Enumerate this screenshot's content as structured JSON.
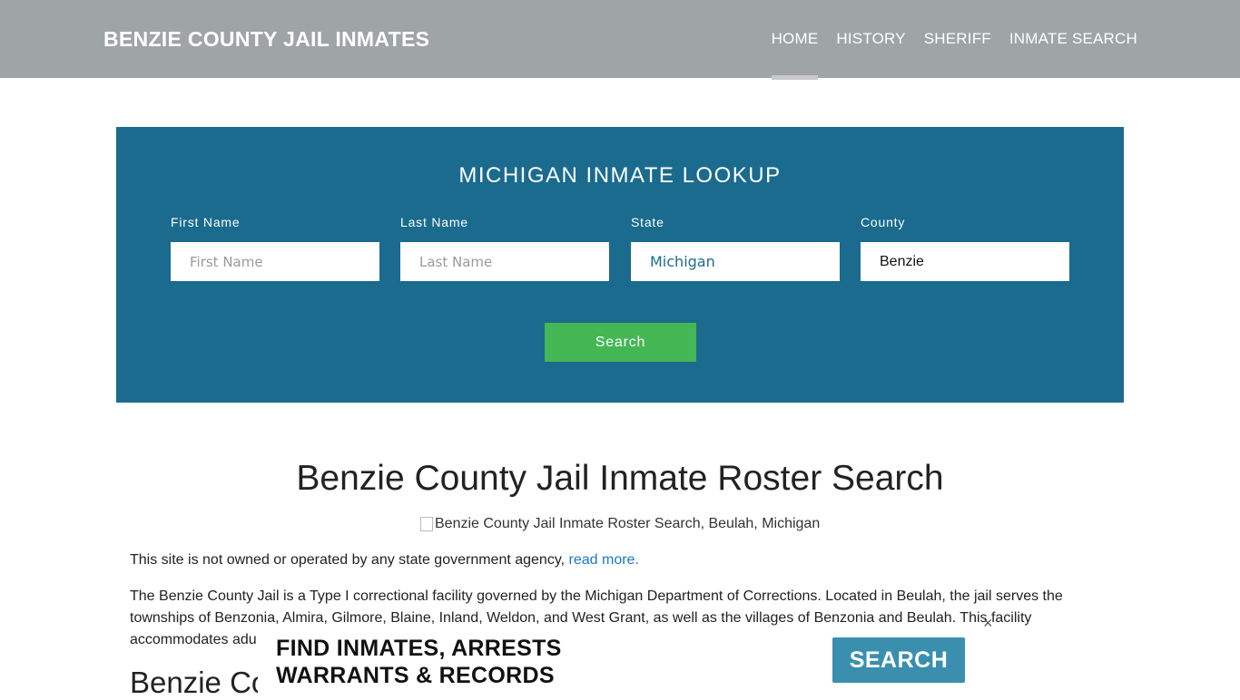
{
  "header": {
    "brand": "BENZIE COUNTY JAIL INMATES",
    "nav": [
      {
        "label": "HOME",
        "active": true
      },
      {
        "label": "HISTORY",
        "active": false
      },
      {
        "label": "SHERIFF",
        "active": false
      },
      {
        "label": "INMATE SEARCH",
        "active": false
      }
    ]
  },
  "lookup": {
    "title": "MICHIGAN INMATE LOOKUP",
    "fields": {
      "first_name": {
        "label": "First Name",
        "placeholder": "First Name",
        "value": ""
      },
      "last_name": {
        "label": "Last Name",
        "placeholder": "Last Name",
        "value": ""
      },
      "state": {
        "label": "State",
        "value": "Michigan"
      },
      "county": {
        "label": "County",
        "value": "Benzie"
      }
    },
    "search_label": "Search"
  },
  "content": {
    "title": "Benzie County Jail Inmate Roster Search",
    "image_alt": "Benzie County Jail Inmate Roster Search, Beulah, Michigan",
    "disclaimer_text": "This site is not owned or operated by any state government agency, ",
    "disclaimer_link": "read more.",
    "body_text": "The Benzie County Jail is a Type I correctional facility governed by the Michigan Department of Corrections. Located in Beulah, the jail serves the townships of Benzonia, Almira, Gilmore, Blaine, Inland, Weldon, and West Grant, as well as the villages of Benzonia and Beulah. This facility accommodates adu",
    "sub_heading": "Benzie Co"
  },
  "ad": {
    "line1": "FIND INMATES, ARRESTS",
    "line2": "WARRANTS & RECORDS",
    "button": "SEARCH",
    "close": "×"
  },
  "colors": {
    "header_bg": "#9fa4a6",
    "panel_bg": "#1a6b8e",
    "search_button": "#43b754",
    "ad_button": "#3a8fae",
    "link": "#1a78c8"
  }
}
